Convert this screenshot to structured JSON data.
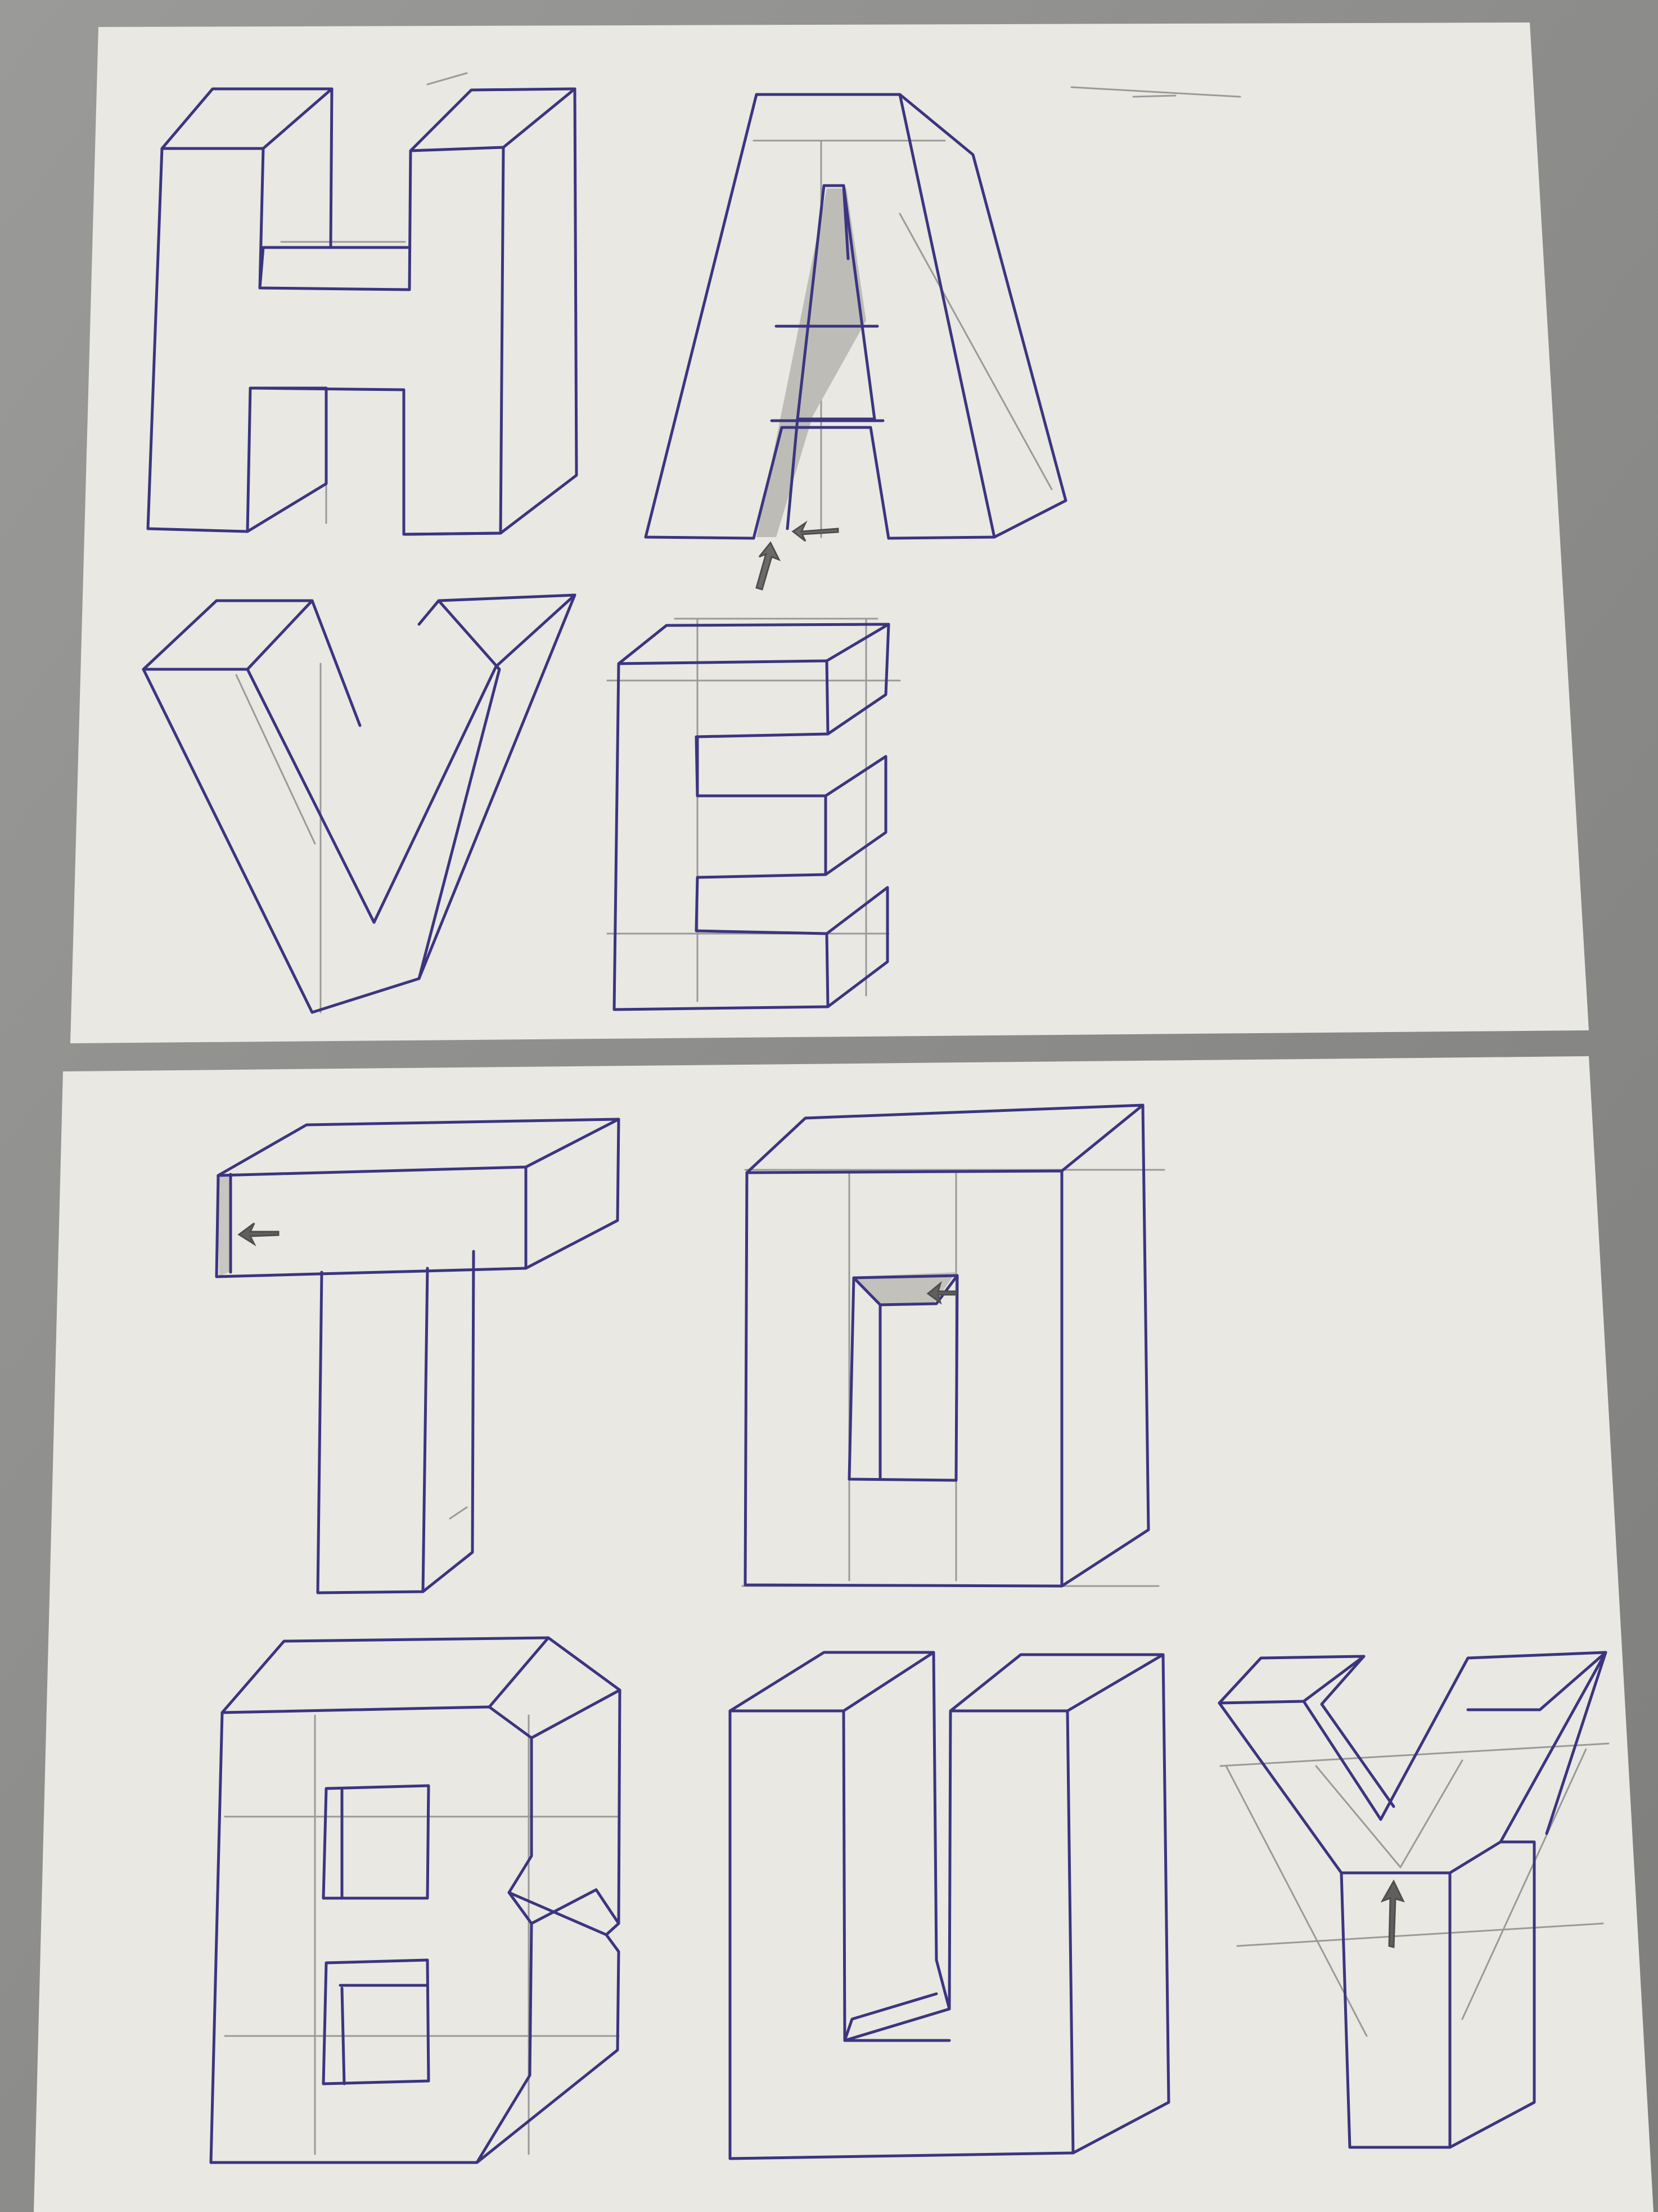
{
  "scene": {
    "description_colors": {
      "background": "#8c8c8a",
      "paper": "#e9e8e2",
      "ink": "#3b3580",
      "pencil": "#9a9a9a",
      "shade": "#b9b7b2"
    }
  },
  "sheets": [
    {
      "letters": [
        "H",
        "A",
        "V",
        "E"
      ]
    },
    {
      "letters": [
        "T",
        "O",
        "B",
        "U",
        "Y"
      ]
    }
  ]
}
